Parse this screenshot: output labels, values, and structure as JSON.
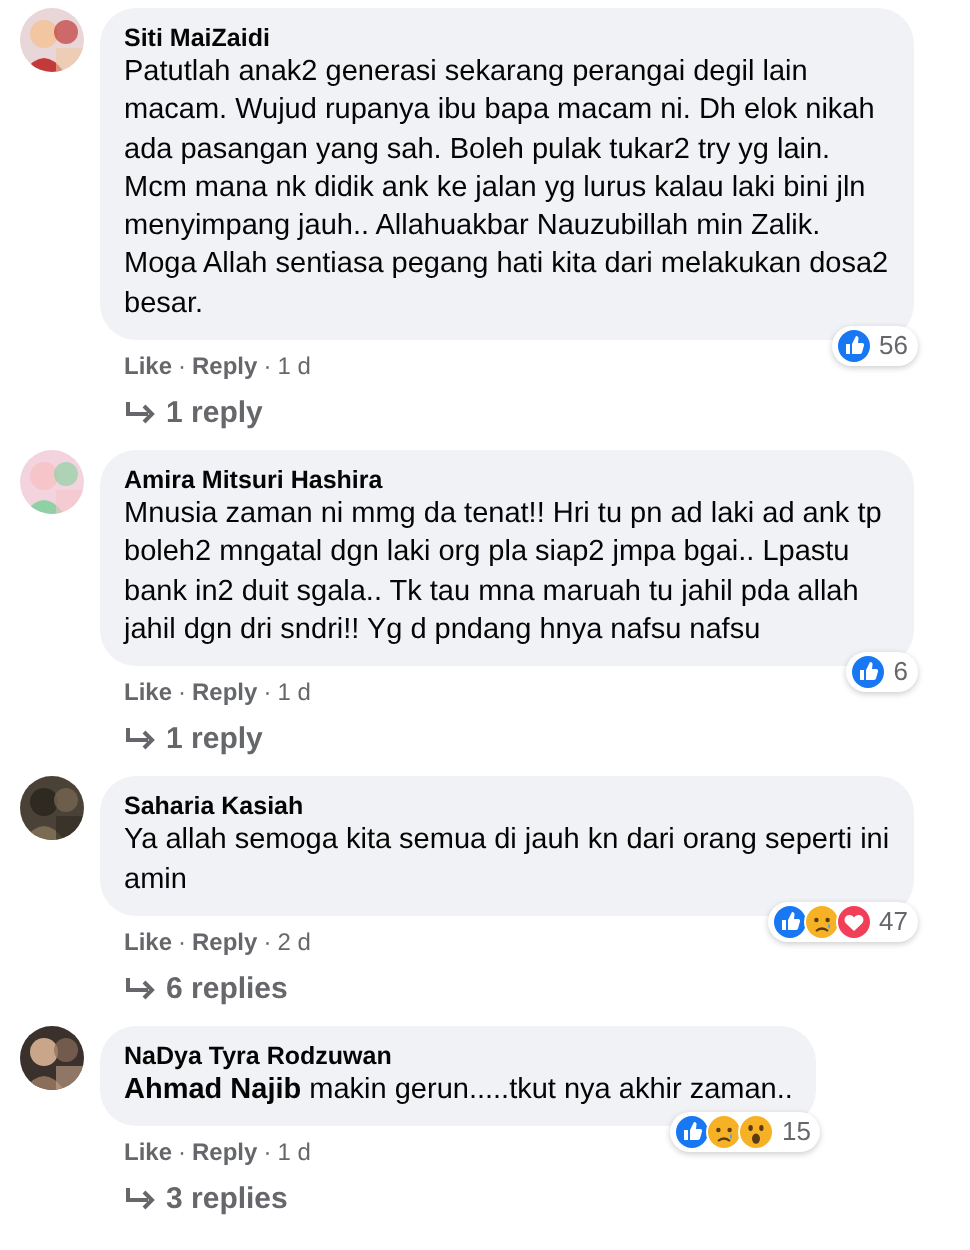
{
  "comments": [
    {
      "author": "Siti MaiZaidi",
      "text": "Patutlah anak2 generasi sekarang perangai degil lain macam. Wujud rupanya ibu bapa macam ni. Dh elok nikah ada pasangan yang sah. Boleh pulak tukar2 try yg lain. Mcm mana nk didik ank ke jalan yg lurus kalau laki bini jln menyimpang jauh.. Allahuakbar Nauzubillah min Zalik. Moga Allah sentiasa pegang hati kita dari melakukan dosa2 besar.",
      "reactions": [
        {
          "kind": "like"
        }
      ],
      "reaction_count": "56",
      "separator": "·",
      "actions": [
        "Like",
        "Reply"
      ],
      "time": "1 d",
      "replies": "1 reply"
    },
    {
      "author": "Amira Mitsuri Hashira",
      "text": "Mnusia zaman ni mmg da tenat!! Hri tu pn ad laki ad ank tp boleh2 mngatal dgn laki org pla siap2 jmpa bgai.. Lpastu bank in2 duit sgala.. Tk tau mna maruah tu jahil pda allah jahil dgn dri sndri!! Yg d pndang hnya nafsu nafsu",
      "reactions": [
        {
          "kind": "like"
        }
      ],
      "reaction_count": "6",
      "separator": "·",
      "actions": [
        "Like",
        "Reply"
      ],
      "time": "1 d",
      "replies": "1 reply"
    },
    {
      "author": "Saharia Kasiah",
      "text": "Ya allah semoga kita semua di jauh kn dari orang seperti ini amin",
      "reactions": [
        {
          "kind": "like"
        },
        {
          "kind": "sad"
        },
        {
          "kind": "love"
        }
      ],
      "reaction_count": "47",
      "separator": "·",
      "actions": [
        "Like",
        "Reply"
      ],
      "time": "2 d",
      "replies": "6 replies"
    },
    {
      "author": "NaDya Tyra Rodzuwan",
      "text": "**Ahmad Najib** makin gerun.....tkut nya akhir zaman..",
      "reactions": [
        {
          "kind": "like"
        },
        {
          "kind": "sad"
        },
        {
          "kind": "wow"
        }
      ],
      "reaction_count": "15",
      "separator": "·",
      "actions": [
        "Like",
        "Reply"
      ],
      "time": "1 d",
      "replies": "3 replies"
    }
  ]
}
